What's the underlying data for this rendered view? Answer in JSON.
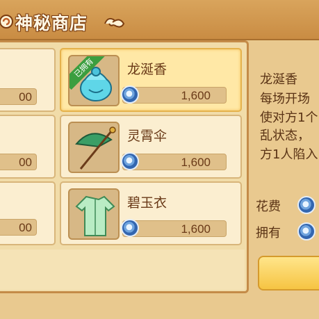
{
  "header": {
    "title": "神秘商店"
  },
  "left_column": {
    "prices": [
      "00",
      "00",
      "00"
    ]
  },
  "items": [
    {
      "name": "龙涎香",
      "price": "1,600",
      "badge": "已拥有",
      "selected": true
    },
    {
      "name": "灵霄伞",
      "price": "1,600",
      "badge": null,
      "selected": false
    },
    {
      "name": "碧玉衣",
      "price": "1,600",
      "badge": null,
      "selected": false
    }
  ],
  "detail": {
    "name": "龙涎香",
    "description": "每场开场\n使对方1个\n乱状态，\n方1人陷入",
    "cost_label": "花费",
    "own_label": "拥有"
  },
  "colors": {
    "title_bg": "#c98c43",
    "panel_bg": "#f1dca9",
    "selected_slot": "#ffe8a6",
    "text_brown": "#6a3a18",
    "badge_green": "#3b9e3f"
  },
  "icons": {
    "title_swirl": "swirl-cloud-icon",
    "currency": "spirit-coin-icon"
  }
}
